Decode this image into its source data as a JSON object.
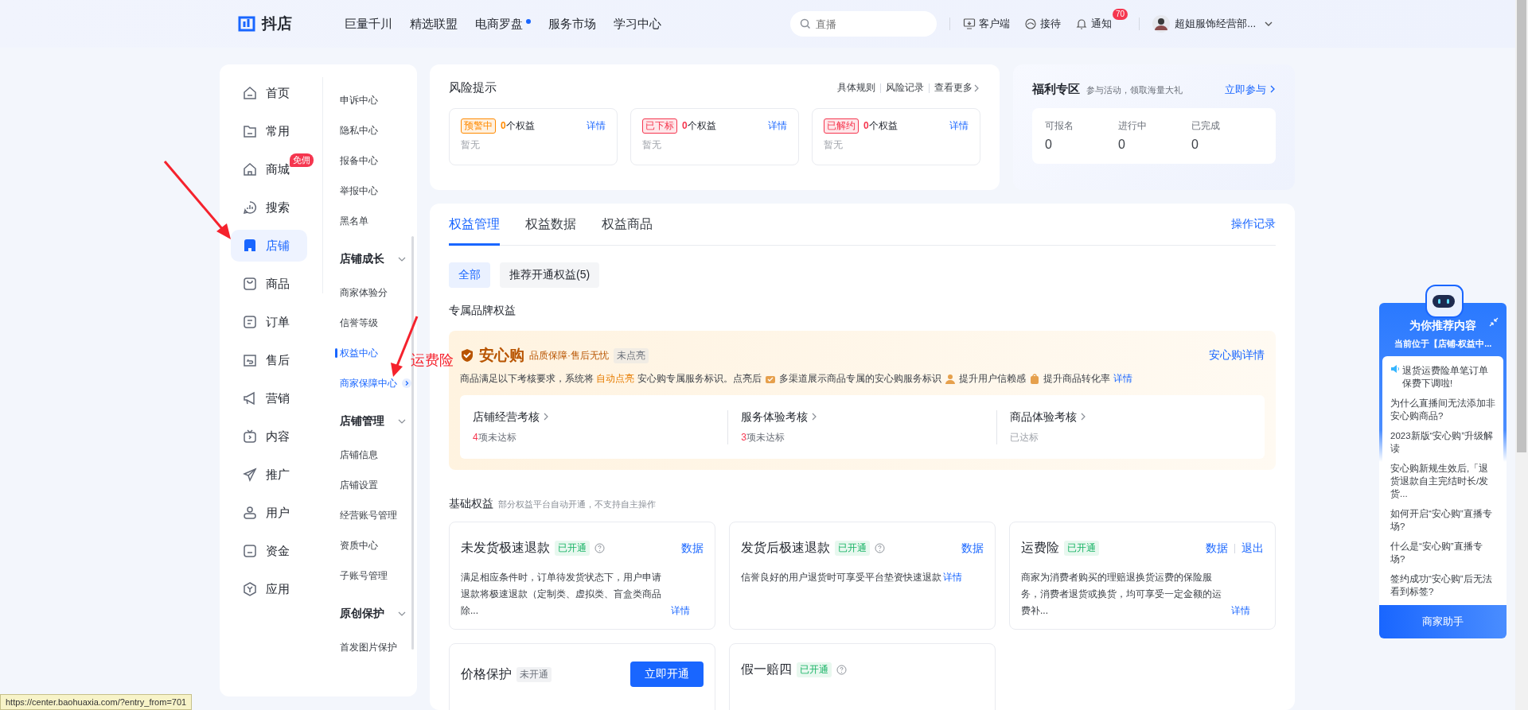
{
  "header": {
    "logo": "抖店",
    "nav": [
      {
        "label": "巨量千川",
        "dot": false
      },
      {
        "label": "精选联盟",
        "dot": false
      },
      {
        "label": "电商罗盘",
        "dot": true
      },
      {
        "label": "服务市场",
        "dot": false
      },
      {
        "label": "学习中心",
        "dot": false
      }
    ],
    "search": {
      "placeholder": "直播"
    },
    "tools": [
      {
        "label": "客户端"
      },
      {
        "label": "接待"
      },
      {
        "label": "通知",
        "badge": "70"
      }
    ],
    "account": "超姐服饰经营部..."
  },
  "sidebar": {
    "items": [
      {
        "label": "首页",
        "selected": false
      },
      {
        "label": "常用",
        "selected": false
      },
      {
        "label": "商城",
        "selected": false,
        "badge": "免佣"
      },
      {
        "label": "搜索",
        "selected": false
      },
      {
        "label": "店铺",
        "selected": true
      },
      {
        "label": "商品",
        "selected": false
      },
      {
        "label": "订单",
        "selected": false
      },
      {
        "label": "售后",
        "selected": false
      },
      {
        "label": "营销",
        "selected": false
      },
      {
        "label": "内容",
        "selected": false
      },
      {
        "label": "推广",
        "selected": false
      },
      {
        "label": "用户",
        "selected": false
      },
      {
        "label": "资金",
        "selected": false
      },
      {
        "label": "应用",
        "selected": false
      }
    ]
  },
  "subnav": {
    "items": [
      {
        "label": "申诉中心",
        "selected": false,
        "hovered": false
      },
      {
        "label": "隐私中心",
        "selected": false,
        "hovered": false
      },
      {
        "label": "报备中心",
        "selected": false,
        "hovered": false
      },
      {
        "label": "举报中心",
        "selected": false,
        "hovered": false
      },
      {
        "label": "黑名单",
        "selected": false,
        "hovered": false
      }
    ],
    "groups": [
      {
        "title": "店铺成长",
        "expanded": true,
        "items": [
          {
            "label": "商家体验分",
            "selected": false,
            "hovered": false
          },
          {
            "label": "信誉等级",
            "selected": false,
            "hovered": false
          },
          {
            "label": "权益中心",
            "selected": true,
            "hovered": false
          },
          {
            "label": "商家保障中心",
            "selected": false,
            "hovered": true
          }
        ]
      },
      {
        "title": "店铺管理",
        "expanded": true,
        "items": [
          {
            "label": "店铺信息",
            "selected": false,
            "hovered": false
          },
          {
            "label": "店铺设置",
            "selected": false,
            "hovered": false
          },
          {
            "label": "经营账号管理",
            "selected": false,
            "hovered": false
          },
          {
            "label": "资质中心",
            "selected": false,
            "hovered": false
          },
          {
            "label": "子账号管理",
            "selected": false,
            "hovered": false
          }
        ]
      },
      {
        "title": "原创保护",
        "expanded": true,
        "items": [
          {
            "label": "首发图片保护",
            "selected": false,
            "hovered": false
          }
        ]
      }
    ]
  },
  "risk": {
    "title": "风险提示",
    "links": [
      "具体规则",
      "风险记录",
      "查看更多"
    ],
    "items": [
      {
        "tag": "预警中",
        "color": "#ff8a00",
        "count": "0",
        "unit": "个权益",
        "link": "详情",
        "note": "暂无"
      },
      {
        "tag": "已下标",
        "color": "#f5364f",
        "count": "0",
        "unit": "个权益",
        "link": "详情",
        "note": "暂无"
      },
      {
        "tag": "已解约",
        "color": "#f5364f",
        "count": "0",
        "unit": "个权益",
        "link": "详情",
        "note": "暂无"
      }
    ]
  },
  "welfare": {
    "title": "福利专区",
    "subtitle": "参与活动，领取海量大礼",
    "link": "立即参与",
    "stats": [
      {
        "label": "可报名",
        "value": "0"
      },
      {
        "label": "进行中",
        "value": "0"
      },
      {
        "label": "已完成",
        "value": "0"
      }
    ]
  },
  "main": {
    "tabs": [
      {
        "label": "权益管理",
        "selected": true
      },
      {
        "label": "权益数据",
        "selected": false
      },
      {
        "label": "权益商品",
        "selected": false
      }
    ],
    "record_link": "操作记录",
    "filters": [
      {
        "label": "全部",
        "selected": true
      },
      {
        "label": "推荐开通权益(5)",
        "selected": false
      }
    ],
    "brand_section": "专属品牌权益",
    "anxin": {
      "logo": "安心购",
      "tagline": "品质保障·售后无忧",
      "tag": "未点亮",
      "link": "安心购详情",
      "intro": {
        "before": "商品满足以下考核要求，系统将 ",
        "highlight": "自动点亮",
        "after": " 安心购专属服务标识。点亮后"
      },
      "perks": [
        "多渠道展示商品专属的安心购服务标识",
        "提升用户信赖感",
        "提升商品转化率"
      ],
      "detail_link": "详情",
      "checks": [
        {
          "title": "店铺经营考核",
          "count": "4",
          "status": "项未达标",
          "passed": false
        },
        {
          "title": "服务体验考核",
          "count": "3",
          "status": "项未达标",
          "passed": false
        },
        {
          "title": "商品体验考核",
          "status": "已达标",
          "passed": true
        }
      ]
    },
    "basic_section": {
      "title": "基础权益",
      "hint": "部分权益平台自动开通，不支持自主操作"
    },
    "benefits": [
      {
        "title": "未发货极速退款",
        "status": "已开通",
        "enabled": true,
        "help": true,
        "actions": [
          "数据"
        ],
        "description": "满足相应条件时，订单待发货状态下，用户申请退款将极速退款（定制类、虚拟类、盲盒类商品除...",
        "detail": "详情"
      },
      {
        "title": "发货后极速退款",
        "status": "已开通",
        "enabled": true,
        "help": true,
        "actions": [
          "数据"
        ],
        "description": "信誉良好的用户退货时可享受平台垫资快速退款",
        "detail": "详情"
      },
      {
        "title": "运费险",
        "status": "已开通",
        "enabled": true,
        "help": false,
        "actions": [
          "数据",
          "退出"
        ],
        "description": "商家为消费者购买的理赔退换货运费的保险服务，消费者退货或换货，均可享受一定金额的运费补...",
        "detail": "详情"
      },
      {
        "title": "价格保护",
        "status": "未开通",
        "enabled": false,
        "help": false,
        "button": "立即开通"
      },
      {
        "title": "假一赔四",
        "status": "已开通",
        "enabled": true,
        "help": true
      }
    ]
  },
  "assistant": {
    "title": "为你推荐内容",
    "subtitle": "当前位于【店铺-权益中...",
    "items": [
      {
        "text": "退货运费险单笔订单保费下调啦!",
        "kind": "notice"
      },
      {
        "text": "为什么直播间无法添加非安心购商品?",
        "kind": "question"
      },
      {
        "text": "2023新版“安心购”升级解读",
        "kind": "question"
      },
      {
        "text": "安心购新规生效后,「退货退款自主完结时长/发货...",
        "kind": "question"
      },
      {
        "text": "如何开启“安心购”直播专场?",
        "kind": "question"
      },
      {
        "text": "什么是“安心购”直播专场?",
        "kind": "question"
      },
      {
        "text": "签约成功“安心购”后无法看到标签?",
        "kind": "question"
      }
    ],
    "button": "商家助手"
  },
  "annotation": {
    "label": "运费险"
  },
  "status_bar": {
    "url": "https://center.baohuaxia.com/?entry_from=701"
  }
}
